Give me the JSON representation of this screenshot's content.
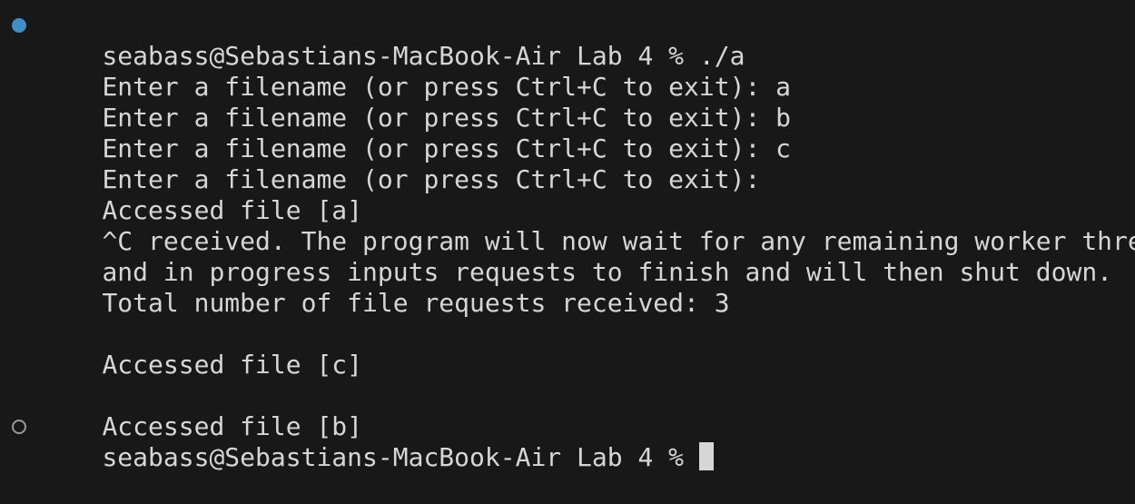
{
  "terminal": {
    "colors": {
      "background": "#181818",
      "text": "#d6d6d6",
      "success_marker": "#3f8fc7",
      "pending_marker_border": "#9a9a9a",
      "cursor": "#d6d6d6"
    },
    "icons": {
      "first_command_marker": "command-success-dot-icon",
      "second_command_marker": "command-pending-ring-icon"
    },
    "lines": [
      "seabass@Sebastians-MacBook-Air Lab 4 % ./a",
      "Enter a filename (or press Ctrl+C to exit): a",
      "Enter a filename (or press Ctrl+C to exit): b",
      "Enter a filename (or press Ctrl+C to exit): c",
      "Enter a filename (or press Ctrl+C to exit):",
      "Accessed file [a]",
      "^C received. The program will now wait for any remaining worker threads",
      "and in progress inputs requests to finish and will then shut down.",
      "Total number of file requests received: 3",
      "",
      "Accessed file [c]",
      "",
      "Accessed file [b]",
      "seabass@Sebastians-MacBook-Air Lab 4 %"
    ]
  }
}
